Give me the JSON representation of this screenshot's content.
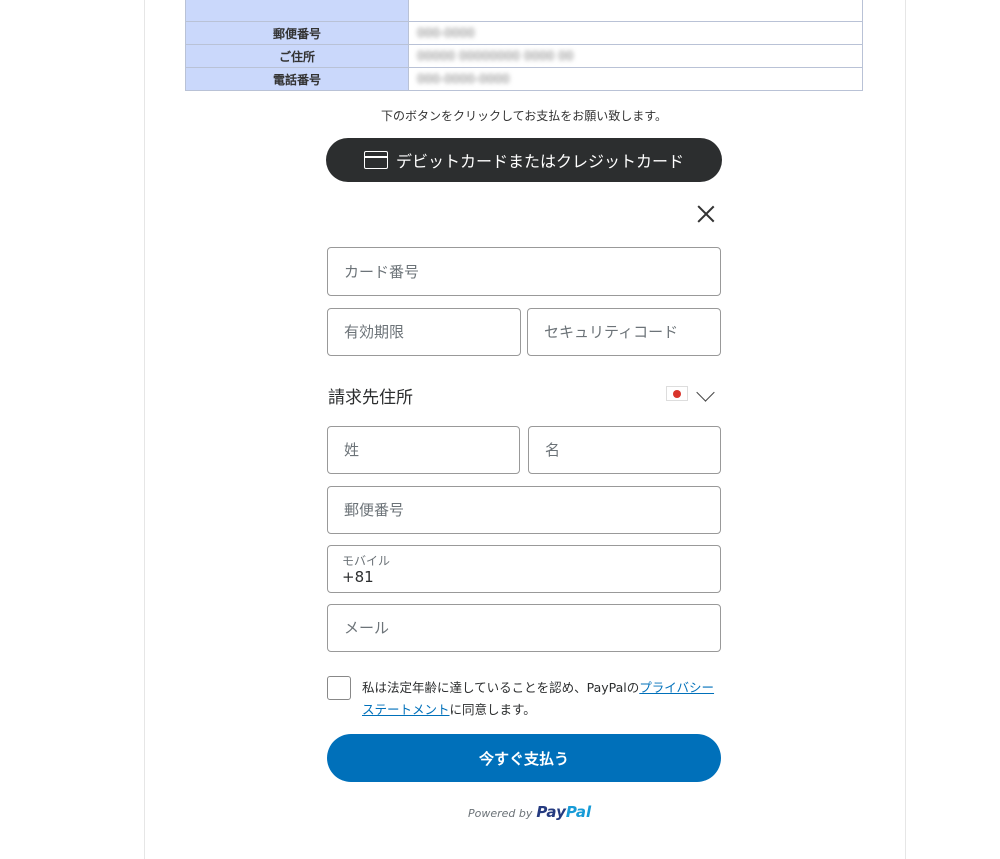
{
  "info_table": {
    "rows": [
      {
        "label": "",
        "value": ""
      },
      {
        "label": "郵便番号",
        "value": "000-0000"
      },
      {
        "label": "ご住所",
        "value": "00000 00000000 0000 00"
      },
      {
        "label": "電話番号",
        "value": "000-0000-0000"
      }
    ]
  },
  "instruction": "下のボタンをクリックしてお支払をお願い致します。",
  "card_button": {
    "label": "デビットカードまたはクレジットカード",
    "icon": "credit-card-icon"
  },
  "form": {
    "card_number_placeholder": "カード番号",
    "expiry_placeholder": "有効期限",
    "security_code_placeholder": "セキュリティコード",
    "billing_title": "請求先住所",
    "country_flag": "japan-flag-icon",
    "last_name_placeholder": "姓",
    "first_name_placeholder": "名",
    "postal_placeholder": "郵便番号",
    "mobile_label": "モバイル",
    "mobile_value": "+81",
    "email_placeholder": "メール"
  },
  "consent": {
    "prefix": "私は法定年齢に達していることを認め、PayPalの",
    "link": "プライバシーステートメント",
    "suffix": "に同意します。"
  },
  "pay_button": {
    "label": "今すぐ支払う"
  },
  "powered": {
    "prefix": "Powered by",
    "brand_a": "Pay",
    "brand_b": "Pal"
  },
  "colors": {
    "primary": "#0070ba",
    "dark_button": "#2c2e2f",
    "table_header": "#cad8fb"
  }
}
